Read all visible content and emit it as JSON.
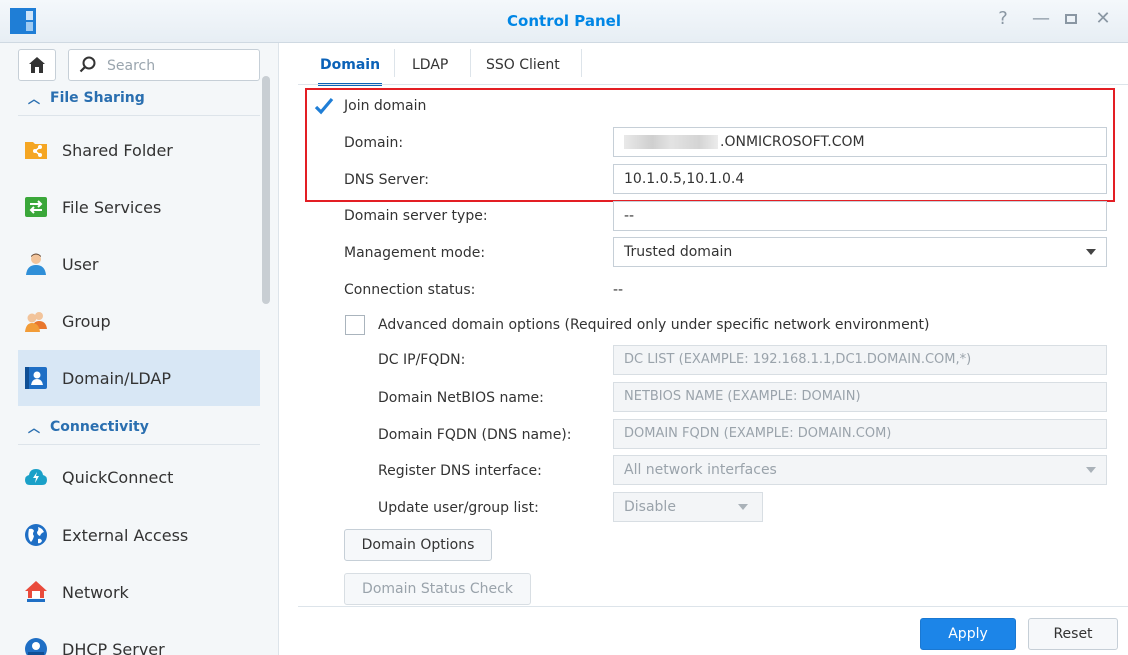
{
  "window": {
    "title": "Control Panel"
  },
  "sidebar": {
    "search_placeholder": "Search",
    "sections": {
      "file_sharing": "File Sharing",
      "connectivity": "Connectivity"
    },
    "items": [
      {
        "label": "Shared Folder"
      },
      {
        "label": "File Services"
      },
      {
        "label": "User"
      },
      {
        "label": "Group"
      },
      {
        "label": "Domain/LDAP"
      },
      {
        "label": "QuickConnect"
      },
      {
        "label": "External Access"
      },
      {
        "label": "Network"
      },
      {
        "label": "DHCP Server"
      }
    ],
    "active": "Domain/LDAP"
  },
  "tabs": [
    {
      "label": "Domain"
    },
    {
      "label": "LDAP"
    },
    {
      "label": "SSO Client"
    }
  ],
  "active_tab": "Domain",
  "form": {
    "join_domain": {
      "label": "Join domain",
      "checked": true
    },
    "domain": {
      "label": "Domain:",
      "value_suffix": ".ONMICROSOFT.COM"
    },
    "dns_server": {
      "label": "DNS Server:",
      "value": "10.1.0.5,10.1.0.4"
    },
    "domain_server_type": {
      "label": "Domain server type:",
      "value": "--"
    },
    "management_mode": {
      "label": "Management mode:",
      "value": "Trusted domain"
    },
    "connection_status": {
      "label": "Connection status:",
      "value": "--"
    },
    "advanced": {
      "label": "Advanced domain options (Required only under specific network environment)",
      "checked": false
    },
    "dc_ip": {
      "label": "DC IP/FQDN:",
      "placeholder": "DC LIST (EXAMPLE: 192.168.1.1,DC1.DOMAIN.COM,*)"
    },
    "netbios": {
      "label": "Domain NetBIOS name:",
      "placeholder": "NETBIOS NAME (EXAMPLE: DOMAIN)"
    },
    "fqdn": {
      "label": "Domain FQDN (DNS name):",
      "placeholder": "DOMAIN FQDN (EXAMPLE: DOMAIN.COM)"
    },
    "register_dns": {
      "label": "Register DNS interface:",
      "value": "All network interfaces"
    },
    "update_list": {
      "label": "Update user/group list:",
      "value": "Disable"
    },
    "domain_options_btn": "Domain Options",
    "domain_status_btn": "Domain Status Check"
  },
  "footer": {
    "apply": "Apply",
    "reset": "Reset"
  },
  "colors": {
    "accent": "#0086e5",
    "highlight": "#e31e24",
    "apply": "#1c85e8"
  }
}
